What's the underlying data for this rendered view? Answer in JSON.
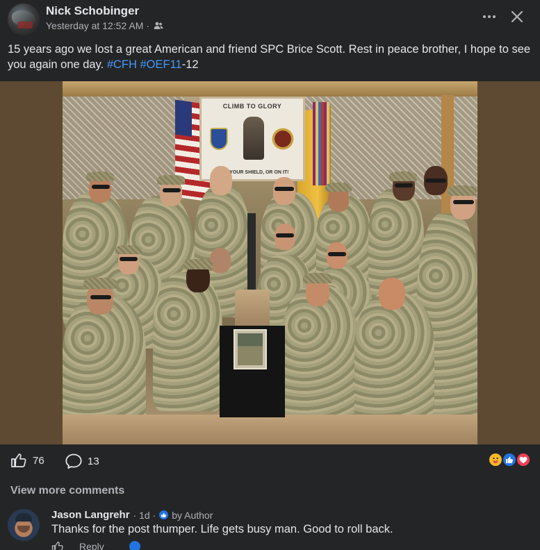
{
  "post": {
    "author": "Nick Schobinger",
    "timestamp": "Yesterday at 12:52 AM",
    "separator": "·",
    "audience_icon": "friends-icon",
    "text_main": "15 years ago we lost a great American and friend SPC Brice Scott. Rest in peace brother, I hope to see you again one day. ",
    "hashtag_1": "#CFH",
    "hashtag_2": "#OEF11",
    "text_suffix": "-12",
    "more_icon": "ellipsis-icon",
    "close_icon": "close-icon"
  },
  "photo": {
    "banner_top": "CLIMB TO GLORY",
    "banner_bottom": "WITH YOUR SHIELD, OR ON IT!"
  },
  "engagement": {
    "like_count": "76",
    "comment_count": "13",
    "reactions": [
      "care-reaction-icon",
      "like-reaction-icon",
      "love-reaction-icon"
    ]
  },
  "comments_section": {
    "view_more_label": "View more comments"
  },
  "comment": {
    "author": "Jason Langrehr",
    "age": "· 1d ·",
    "badge_label": "by Author",
    "text": "Thanks for the post thumper. Life gets busy man. Good to roll back.",
    "reply_label": "Reply"
  },
  "colors": {
    "background": "#242526",
    "text_primary": "#e4e6eb",
    "text_secondary": "#b0b3b8",
    "hashtag": "#4599ff",
    "like_blue": "#2374e1",
    "love_red": "#f33e58",
    "care_yellow": "#f7b928"
  }
}
